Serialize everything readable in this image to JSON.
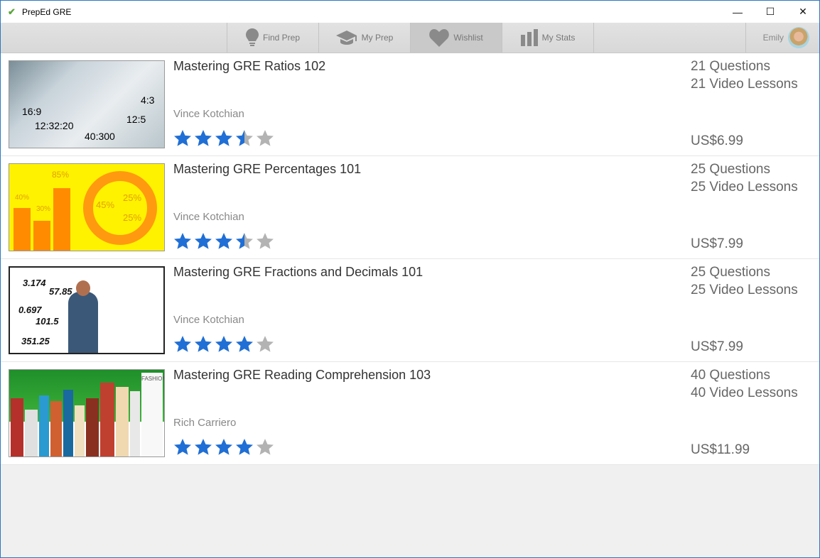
{
  "window": {
    "title": "PrepEd GRE",
    "minimize": "—",
    "maximize": "☐",
    "close": "✕"
  },
  "nav": {
    "items": [
      {
        "label": "Find Prep",
        "icon": "lightbulb-icon"
      },
      {
        "label": "My Prep",
        "icon": "graduation-cap-icon"
      },
      {
        "label": "Wishlist",
        "icon": "heart-icon",
        "active": true
      },
      {
        "label": "My Stats",
        "icon": "bar-chart-icon"
      }
    ],
    "user": "Emily"
  },
  "colors": {
    "star_filled": "#1f6fd6",
    "star_empty": "#b3b3b3"
  },
  "courses": [
    {
      "title": "Mastering GRE Ratios 102",
      "author": "Vince Kotchian",
      "rating": 3.5,
      "questions": "21 Questions",
      "videos": "21 Video Lessons",
      "price": "US$6.99",
      "thumb_text": [
        "4:3",
        "16:9",
        "12:5",
        "12:32:20",
        "40:300"
      ]
    },
    {
      "title": "Mastering GRE Percentages 101",
      "author": "Vince Kotchian",
      "rating": 3.5,
      "questions": "25 Questions",
      "videos": "25 Video Lessons",
      "price": "US$7.99",
      "thumb_text": [
        "85%",
        "40%",
        "30%",
        "45%",
        "25%",
        "25%"
      ]
    },
    {
      "title": "Mastering GRE Fractions and Decimals 101",
      "author": "Vince Kotchian",
      "rating": 4,
      "questions": "25 Questions",
      "videos": "25 Video Lessons",
      "price": "US$7.99",
      "thumb_text": [
        "3.174",
        "57.85",
        "0.697",
        "101.5",
        "351.25"
      ]
    },
    {
      "title": "Mastering GRE Reading Comprehension 103",
      "author": "Rich Carriero",
      "rating": 4,
      "questions": "40 Questions",
      "videos": "40 Video Lessons",
      "price": "US$11.99",
      "thumb_text": [
        "FASHION"
      ]
    }
  ]
}
